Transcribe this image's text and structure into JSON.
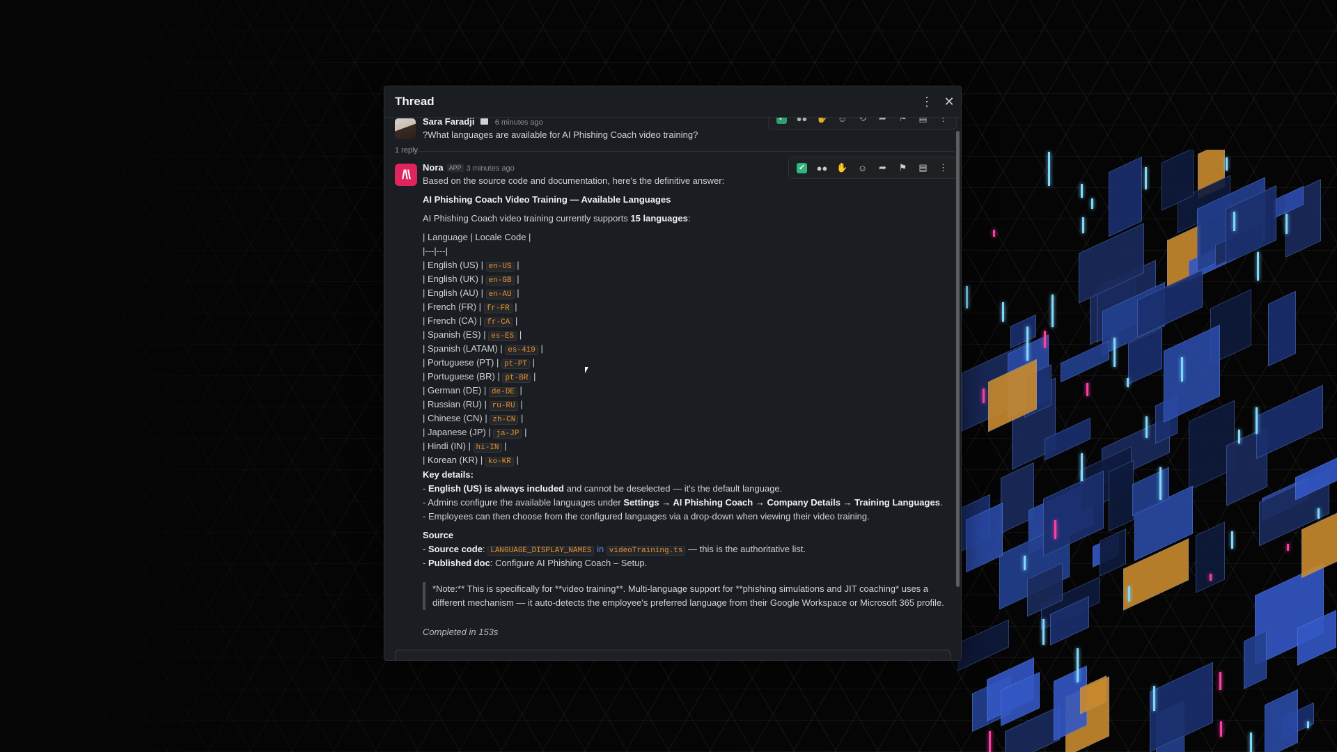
{
  "thread": {
    "title": "Thread",
    "more_icon": "vertical-ellipsis-icon",
    "close_icon": "close-icon"
  },
  "parent_message": {
    "author": "Sara Faradji",
    "timestamp": "6 minutes ago",
    "text": "?What languages are available for AI Phishing Coach video training?"
  },
  "reply_count": "1 reply",
  "toolbar_icons": [
    "check-mark-icon",
    "eyes-icon",
    "raised-hands-icon",
    "add-reaction-icon",
    "share-icon",
    "bookmark-icon",
    "save-icon",
    "more-actions-icon"
  ],
  "reply": {
    "author": "Nora",
    "badge": "APP",
    "timestamp": "3 minutes ago",
    "intro": "Based on the source code and documentation, here's the definitive answer:",
    "heading": "AI Phishing Coach Video Training — Available Languages",
    "support_prefix": "AI Phishing Coach video training currently supports ",
    "support_count": "15 languages",
    "support_suffix": ":",
    "table_header": "| Language | Locale Code |",
    "table_sep": "|---|---|",
    "languages": [
      {
        "name": "English (US)",
        "code": "en-US"
      },
      {
        "name": "English (UK)",
        "code": "en-GB"
      },
      {
        "name": "English (AU)",
        "code": "en-AU"
      },
      {
        "name": "French (FR)",
        "code": "fr-FR"
      },
      {
        "name": "French (CA)",
        "code": "fr-CA"
      },
      {
        "name": "Spanish (ES)",
        "code": "es-ES"
      },
      {
        "name": "Spanish (LATAM)",
        "code": "es-419"
      },
      {
        "name": "Portuguese (PT)",
        "code": "pt-PT"
      },
      {
        "name": "Portuguese (BR)",
        "code": "pt-BR"
      },
      {
        "name": "German (DE)",
        "code": "de-DE"
      },
      {
        "name": "Russian (RU)",
        "code": "ru-RU"
      },
      {
        "name": "Chinese (CN)",
        "code": "zh-CN"
      },
      {
        "name": "Japanese (JP)",
        "code": "ja-JP"
      },
      {
        "name": "Hindi (IN)",
        "code": "hi-IN"
      },
      {
        "name": "Korean (KR)",
        "code": "ko-KR"
      }
    ],
    "key_details_heading": "Key details:",
    "detail1_bold": "English (US) is always included",
    "detail1_rest": " and cannot be deselected — it's the default language.",
    "detail2_prefix": "- Admins configure the available languages under ",
    "detail2_path": "Settings → AI Phishing Coach → Company Details → Training Languages",
    "detail2_suffix": ".",
    "detail3": "- Employees can then choose from the configured languages via a drop-down when viewing their video training.",
    "source_heading": "Source",
    "source_code_label": "Source code",
    "source_code_const": "LANGUAGE_DISPLAY_NAMES",
    "source_code_in": " in ",
    "source_code_file": "videoTraining.ts",
    "source_code_suffix": " — this is the authoritative list.",
    "published_label": "Published doc",
    "published_text": ": Configure AI Phishing Coach – Setup.",
    "note": "*Note:** This is specifically for **video training**. Multi-language support for **phishing simulations and JIT coaching* uses a different mechanism — it auto-detects the employee's preferred language from their Google Workspace or Microsoft 365 profile.",
    "completed": "Completed in 153s"
  },
  "colors": {
    "panel_bg": "#1a1d21",
    "code_text": "#e8912d",
    "nora_avatar": "#e0245e",
    "check_green": "#2eb67d"
  }
}
